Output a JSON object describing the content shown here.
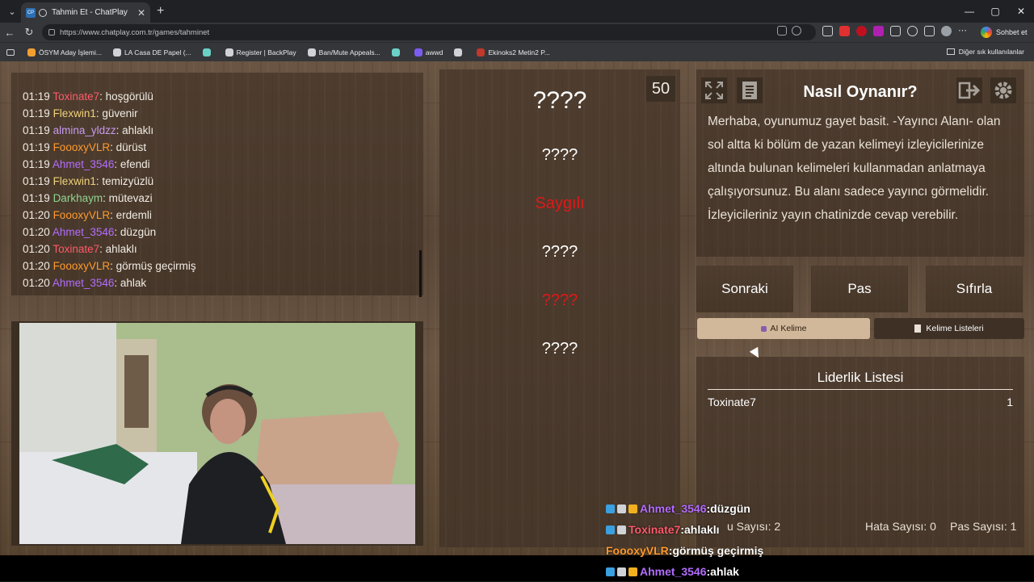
{
  "browser": {
    "tab_badge": "CP",
    "tab_title": "Tahmin Et - ChatPlay",
    "tab_close": "✕",
    "new_tab": "+",
    "url": "https://www.chatplay.com.tr/games/tahminet",
    "profile_button": "Sohbet et",
    "window_controls": [
      "—",
      "▢",
      "✕"
    ],
    "bookmarks": [
      {
        "label": "ÖSYM Aday İşlemi...",
        "color": "#f0a030"
      },
      {
        "label": "LA Casa DE Papel (...",
        "color": "#cfd2d6"
      },
      {
        "label": "",
        "color": "#6ad0c6"
      },
      {
        "label": "Register | BackPlay",
        "color": "#cfd2d6"
      },
      {
        "label": "Ban/Mute Appeals...",
        "color": "#cfd2d6"
      },
      {
        "label": "",
        "color": "#6ad0c6"
      },
      {
        "label": "awwd",
        "color": "#7b5cf0"
      },
      {
        "label": "",
        "color": "#cfd2d6"
      },
      {
        "label": "Ekinoks2 Metin2 P...",
        "color": "#c0392b"
      }
    ],
    "other_bookmarks": "Diğer sık kullanılanlar"
  },
  "chat": {
    "lines": [
      {
        "time": "01:19",
        "user": "Toxinate7",
        "color": "#ff5a6a",
        "msg": "hoşgörülü"
      },
      {
        "time": "01:19",
        "user": "Flexwin1",
        "color": "#f0d27a",
        "msg": "güvenir"
      },
      {
        "time": "01:19",
        "user": "almina_yldzz",
        "color": "#c79af0",
        "msg": "ahlaklı"
      },
      {
        "time": "01:19",
        "user": "FoooxyVLR",
        "color": "#ff9a2e",
        "msg": "dürüst"
      },
      {
        "time": "01:19",
        "user": "Ahmet_3546",
        "color": "#b36cff",
        "msg": "efendi"
      },
      {
        "time": "01:19",
        "user": "Flexwin1",
        "color": "#f0d27a",
        "msg": "temizyüzlü"
      },
      {
        "time": "01:19",
        "user": "Darkhaym",
        "color": "#8fd48f",
        "msg": "mütevazi"
      },
      {
        "time": "01:20",
        "user": "FoooxyVLR",
        "color": "#ff9a2e",
        "msg": "erdemli"
      },
      {
        "time": "01:20",
        "user": "Ahmet_3546",
        "color": "#b36cff",
        "msg": "düzgün"
      },
      {
        "time": "01:20",
        "user": "Toxinate7",
        "color": "#ff5a6a",
        "msg": "ahlaklı"
      },
      {
        "time": "01:20",
        "user": "FoooxyVLR",
        "color": "#ff9a2e",
        "msg": "görmüş geçirmiş"
      },
      {
        "time": "01:20",
        "user": "Ahmet_3546",
        "color": "#b36cff",
        "msg": "ahlak"
      }
    ]
  },
  "game": {
    "counter": "50",
    "words": [
      {
        "text": "????",
        "color": "#ffffff",
        "size": 30
      },
      {
        "text": "????",
        "color": "#ffffff",
        "size": 20
      },
      {
        "text": "Saygılı",
        "color": "#e01818",
        "size": 20
      },
      {
        "text": "????",
        "color": "#ffffff",
        "size": 20
      },
      {
        "text": "????",
        "color": "#e01818",
        "size": 20
      },
      {
        "text": "????",
        "color": "#ffffff",
        "size": 20
      }
    ]
  },
  "howto": {
    "title": "Nasıl Oynanır?",
    "text": "Merhaba, oyunumuz gayet basit. -Yayıncı Alanı- olan sol altta ki bölüm de yazan kelimeyi izleyicilerinize altında bulunan kelimeleri kullanmadan anlatmaya çalışıyorsunuz. Bu alanı sadece yayıncı görmelidir. İzleyicileriniz yayın chatinizde cevap verebilir."
  },
  "controls": {
    "next": "Sonraki",
    "pass": "Pas",
    "reset": "Sıfırla",
    "ai_word": "AI Kelime",
    "word_lists": "Kelime Listeleri"
  },
  "leaderboard": {
    "title": "Liderlik Listesi",
    "rows": [
      {
        "name": "Toxinate7",
        "score": "1"
      }
    ]
  },
  "stats": {
    "correct_fragment": "u Sayısı: 2",
    "errors": "Hata Sayısı: 0",
    "passes": "Pas Sayısı: 1"
  },
  "overlay_chat": [
    {
      "user": "Ahmet_3546",
      "color": "#b36cff",
      "msg": "düzgün",
      "badges": [
        "#3aa0e0",
        "#cfd2d6",
        "#f0b020"
      ]
    },
    {
      "user": "Toxinate7",
      "color": "#ff5a6a",
      "msg": "ahlaklı",
      "badges": [
        "#3aa0e0",
        "#cfd2d6"
      ]
    },
    {
      "user": "FoooxyVLR",
      "color": "#ff9a2e",
      "msg": "görmüş geçirmiş",
      "badges": []
    },
    {
      "user": "Ahmet_3546",
      "color": "#b36cff",
      "msg": "ahlak",
      "badges": [
        "#3aa0e0",
        "#cfd2d6",
        "#f0b020"
      ]
    }
  ]
}
